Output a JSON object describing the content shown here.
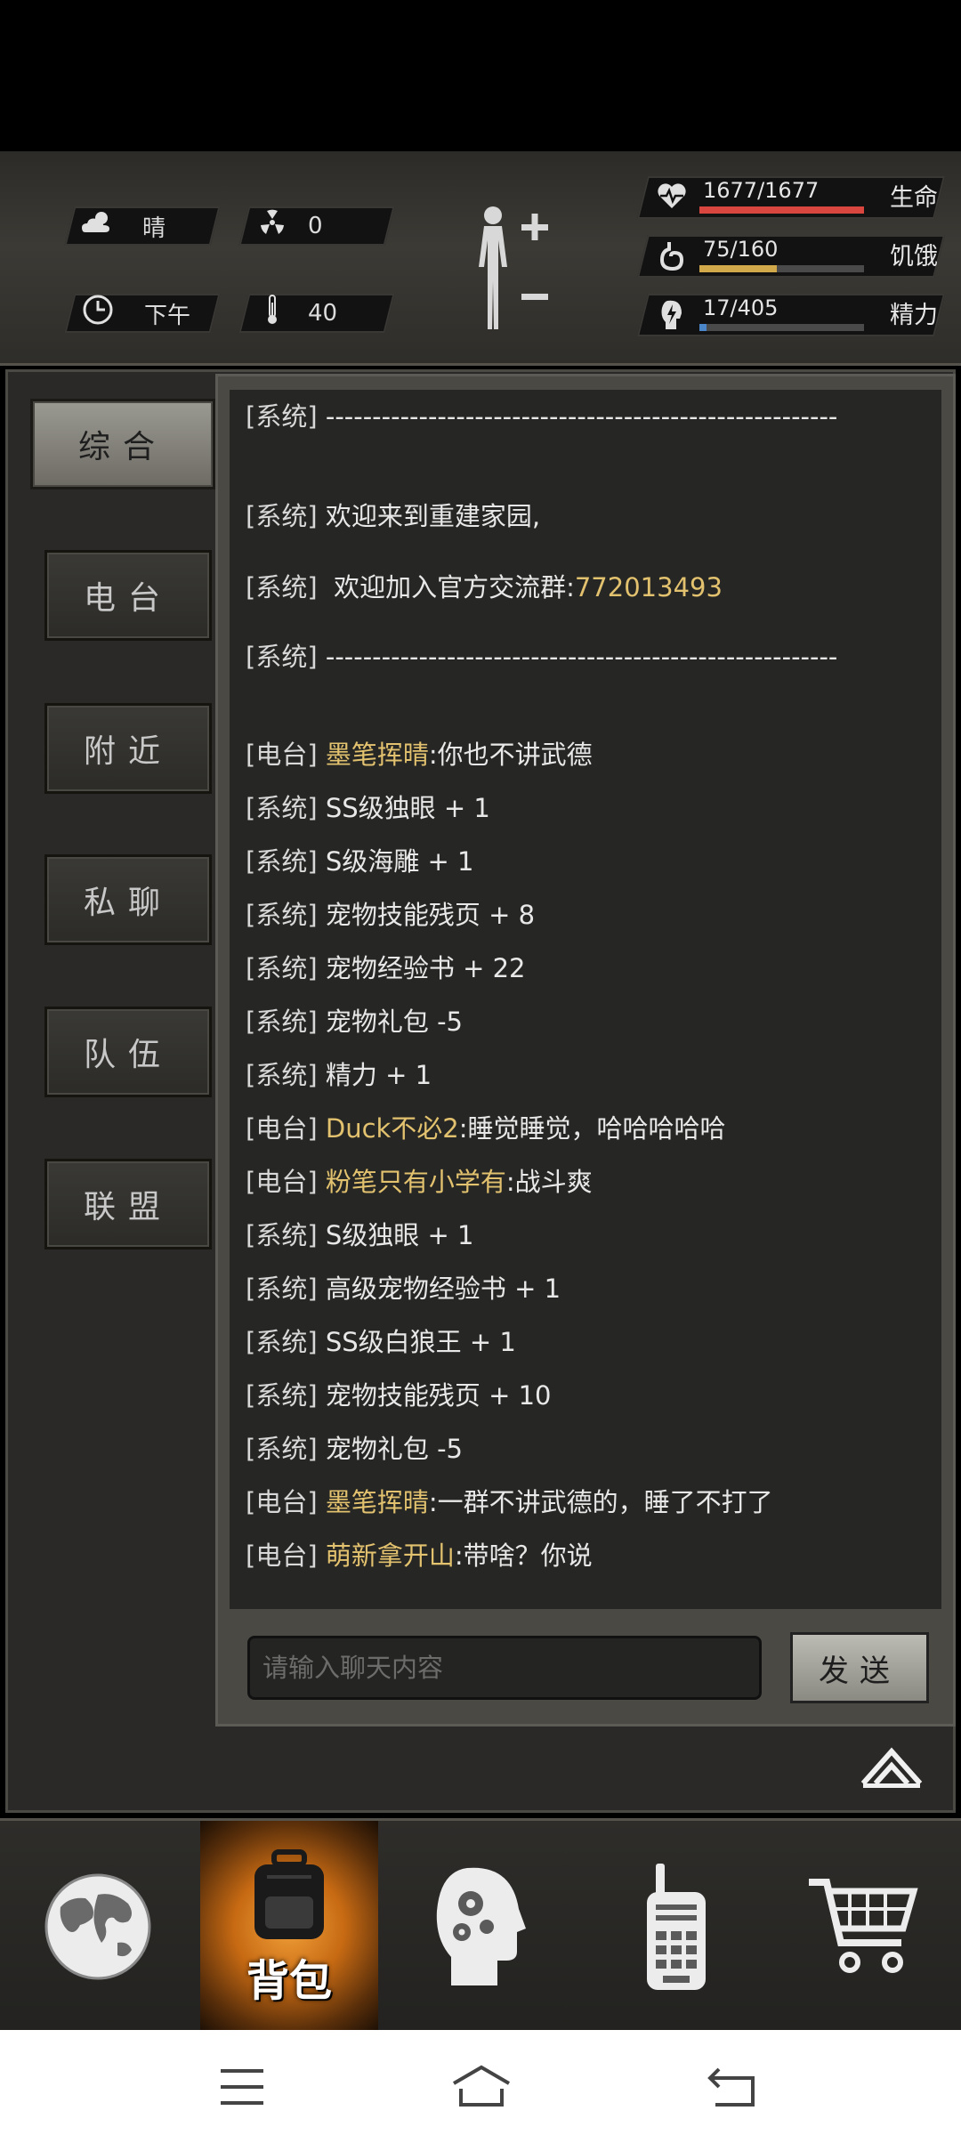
{
  "status": {
    "weather": {
      "icon": "cloud-sun-icon",
      "label": "晴"
    },
    "radiation": {
      "icon": "radiation-icon",
      "value": "0"
    },
    "time_of_day": {
      "icon": "clock-icon",
      "label": "下午"
    },
    "temperature": {
      "icon": "thermometer-icon",
      "value": "40"
    },
    "bars": [
      {
        "name": "life",
        "icon": "heart-pulse-icon",
        "value": "1677/1677",
        "label": "生命",
        "fraction": 1.0,
        "color": "#d9463f"
      },
      {
        "name": "hunger",
        "icon": "stomach-icon",
        "value": "75/160",
        "label": "饥饿",
        "fraction": 0.47,
        "color": "#d2a94a"
      },
      {
        "name": "energy",
        "icon": "lightning-head-icon",
        "value": "17/405",
        "label": "精力",
        "fraction": 0.042,
        "color": "#4b86c9"
      }
    ]
  },
  "tabs": [
    {
      "label": "综合",
      "active": true
    },
    {
      "label": "电台",
      "active": false
    },
    {
      "label": "附近",
      "active": false
    },
    {
      "label": "私聊",
      "active": false
    },
    {
      "label": "队伍",
      "active": false
    },
    {
      "label": "联盟",
      "active": false
    }
  ],
  "messages": [
    {
      "tag": "[系统]",
      "name": "",
      "text": "-------------------------------------------------------"
    },
    {
      "tag": "[系统]",
      "name": "",
      "text": "欢迎来到重建家园,"
    },
    {
      "tag": "[系统]",
      "name": "",
      "text": " 欢迎加入官方交流群:",
      "highlight": "772013493"
    },
    {
      "tag": "[系统]",
      "name": "",
      "text": "-------------------------------------------------------"
    },
    {
      "tag": "[电台]",
      "name": "墨笔挥晴",
      "text": ":你也不讲武德"
    },
    {
      "tag": "[系统]",
      "name": "",
      "text": "SS级独眼 + 1"
    },
    {
      "tag": "[系统]",
      "name": "",
      "text": "S级海雕 + 1"
    },
    {
      "tag": "[系统]",
      "name": "",
      "text": "宠物技能残页 + 8"
    },
    {
      "tag": "[系统]",
      "name": "",
      "text": "宠物经验书 + 22"
    },
    {
      "tag": "[系统]",
      "name": "",
      "text": "宠物礼包 -5"
    },
    {
      "tag": "[系统]",
      "name": "",
      "text": "精力 + 1"
    },
    {
      "tag": "[电台]",
      "name": "Duck不必2",
      "text": ":睡觉睡觉，哈哈哈哈哈"
    },
    {
      "tag": "[电台]",
      "name": "粉笔只有小学有",
      "text": ":战斗爽"
    },
    {
      "tag": "[系统]",
      "name": "",
      "text": "S级独眼 + 1"
    },
    {
      "tag": "[系统]",
      "name": "",
      "text": "高级宠物经验书 + 1"
    },
    {
      "tag": "[系统]",
      "name": "",
      "text": "SS级白狼王 + 1"
    },
    {
      "tag": "[系统]",
      "name": "",
      "text": "宠物技能残页 + 10"
    },
    {
      "tag": "[系统]",
      "name": "",
      "text": "宠物礼包 -5"
    },
    {
      "tag": "[电台]",
      "name": "墨笔挥晴",
      "text": ":一群不讲武德的，睡了不打了"
    },
    {
      "tag": "[电台]",
      "name": "萌新拿开山",
      "text": ":带啥？你说"
    }
  ],
  "input": {
    "placeholder": "请输入聊天内容"
  },
  "send_label": "发送",
  "dock": [
    {
      "icon": "globe-icon",
      "label": ""
    },
    {
      "icon": "backpack-icon",
      "label": "背包",
      "active": true
    },
    {
      "icon": "head-gears-icon",
      "label": ""
    },
    {
      "icon": "walkie-talkie-icon",
      "label": ""
    },
    {
      "icon": "shopping-cart-icon",
      "label": ""
    }
  ]
}
